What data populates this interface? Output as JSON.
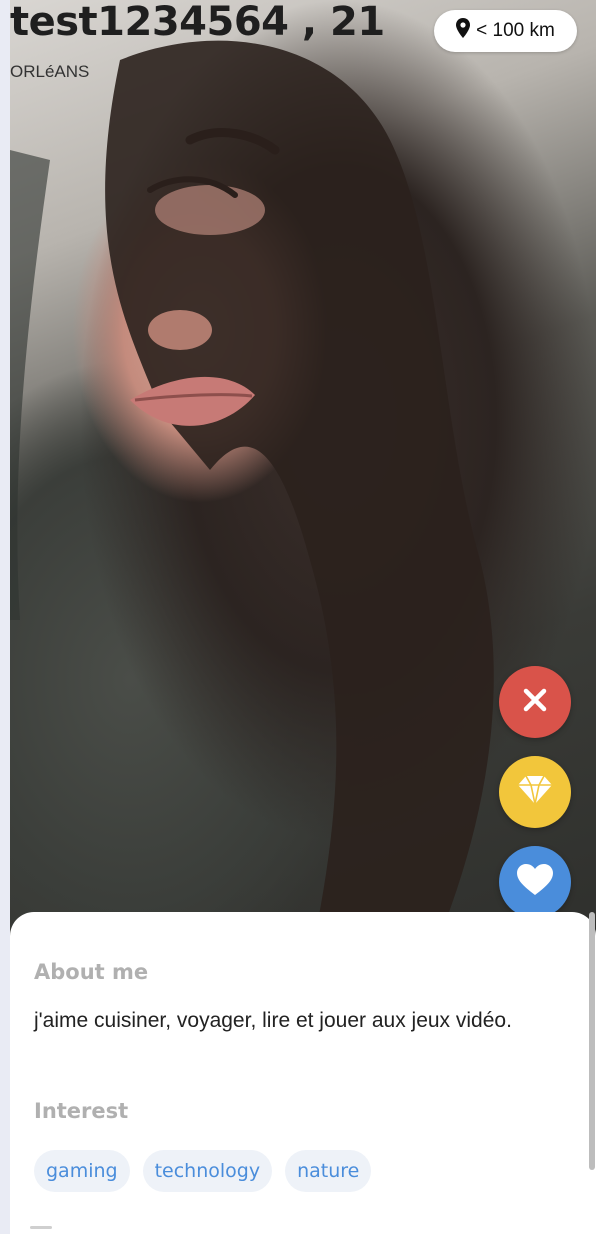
{
  "profile": {
    "name_age": "test1234564 , 21",
    "city": "ORLéANS",
    "distance": "< 100 km"
  },
  "icons": {
    "pin": "map-pin-icon",
    "pass": "close-icon",
    "super_like": "diamond-icon",
    "like": "heart-icon"
  },
  "colors": {
    "pass": "#d9534a",
    "super_like": "#f2c63b",
    "like": "#4a8ddb",
    "tag_text": "#4a8ddb",
    "section_title": "#b0b0b0"
  },
  "about": {
    "title": "About me",
    "text": "j'aime cuisiner, voyager, lire et jouer aux jeux vidéo."
  },
  "interests": {
    "title": "Interest",
    "tags": [
      "gaming",
      "technology",
      "nature"
    ]
  }
}
